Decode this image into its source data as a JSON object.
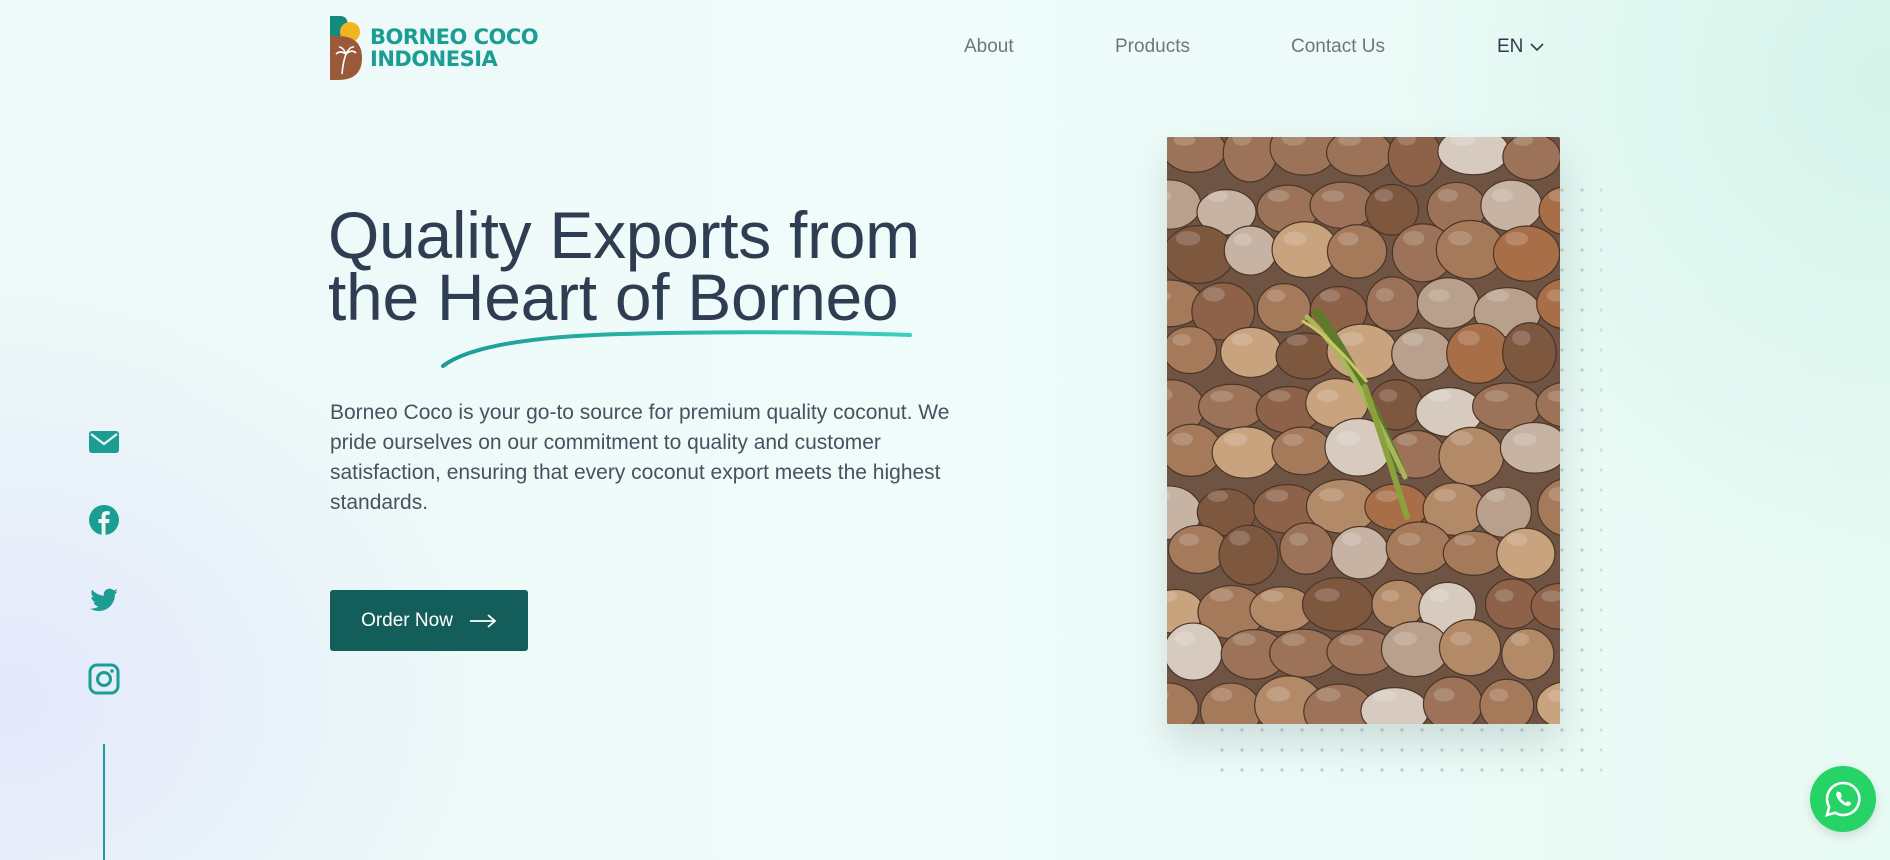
{
  "brand": {
    "name_line1": "BORNEO COCO",
    "name_line2": "INDONESIA",
    "colors": {
      "teal": "#1b9d93",
      "dark_teal": "#135e5a",
      "brown": "#9a5a3a",
      "yellow": "#f2b522"
    }
  },
  "nav": {
    "items": [
      {
        "label": "About"
      },
      {
        "label": "Products"
      },
      {
        "label": "Contact Us"
      }
    ],
    "language": {
      "selected": "EN",
      "icon": "chevron-down-icon"
    }
  },
  "hero": {
    "headline_line1": "Quality Exports from",
    "headline_line2": "the Heart of Borneo",
    "description": "Borneo Coco is your go-to source for premium quality coconut. We pride ourselves on our commitment to quality and customer satisfaction, ensuring that every coconut export meets the highest standards.",
    "cta_label": "Order Now",
    "cta_icon": "arrow-right-icon"
  },
  "social": [
    {
      "name": "email",
      "icon": "envelope-icon"
    },
    {
      "name": "facebook",
      "icon": "facebook-icon"
    },
    {
      "name": "twitter",
      "icon": "twitter-icon"
    },
    {
      "name": "instagram",
      "icon": "instagram-icon"
    }
  ],
  "floating": {
    "whatsapp_icon": "whatsapp-icon",
    "color": "#25d366"
  }
}
